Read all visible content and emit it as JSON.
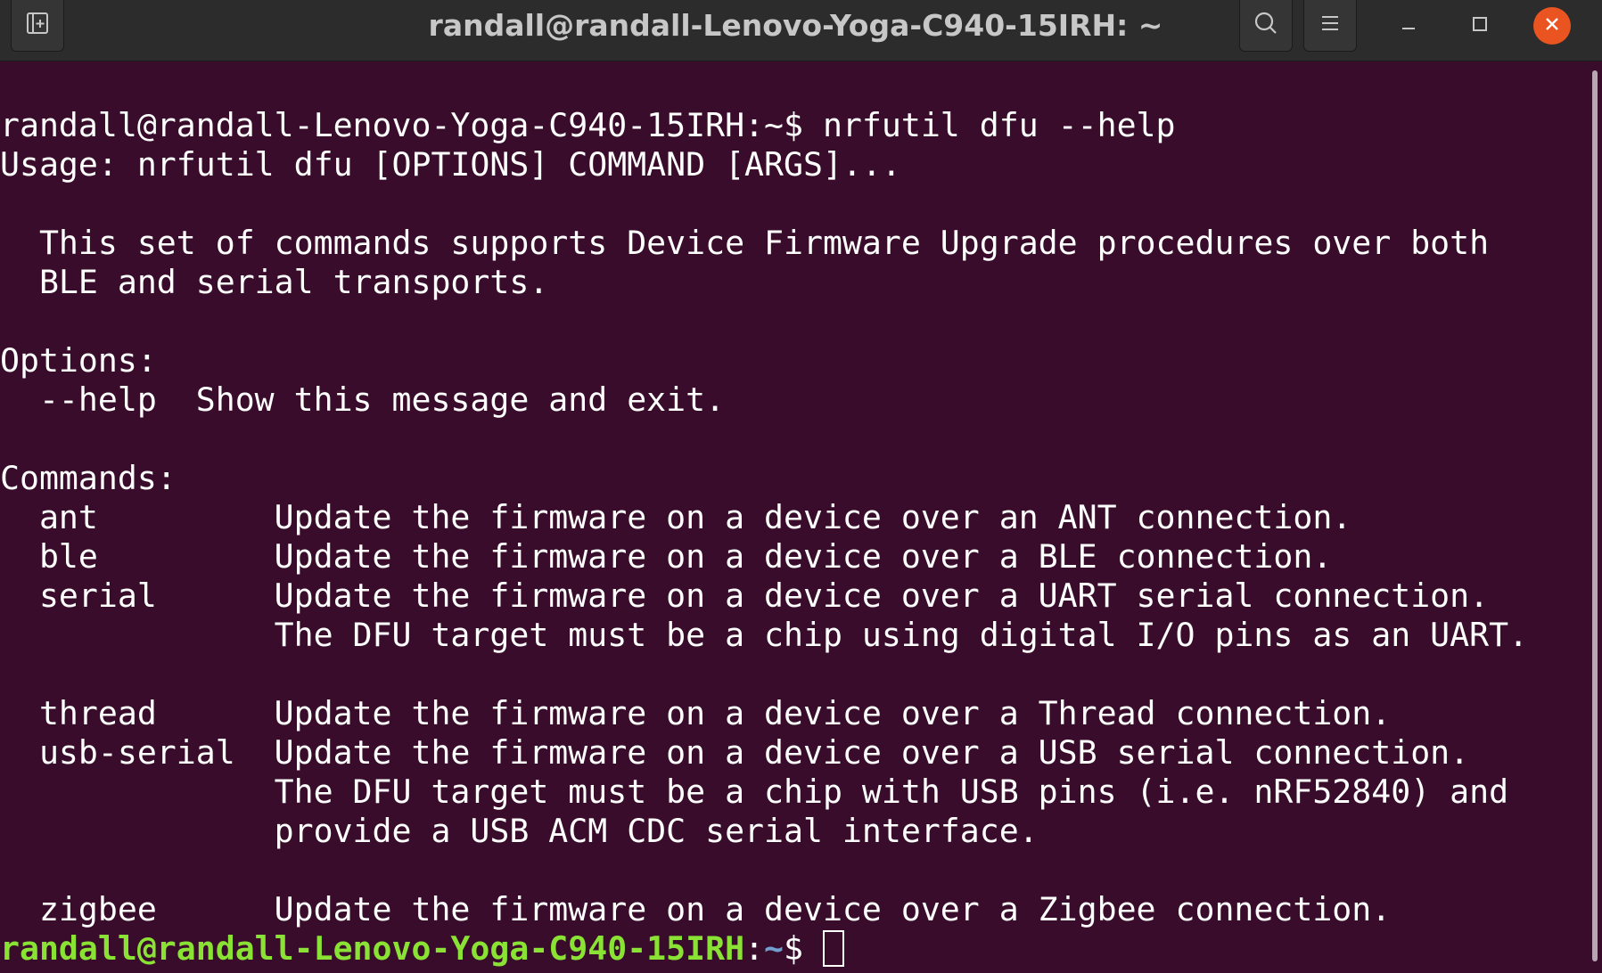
{
  "window": {
    "title": "randall@randall-Lenovo-Yoga-C940-15IRH: ~"
  },
  "icons": {
    "new_tab": "new-tab-icon",
    "search": "search-icon",
    "menu": "hamburger-menu-icon",
    "minimize": "minimize-icon",
    "maximize": "maximize-icon",
    "close": "close-icon"
  },
  "colors": {
    "background": "#380c2a",
    "titlebar": "#2c2c2c",
    "prompt_user": "#8ae234",
    "prompt_path": "#729fcf",
    "close_button": "#e95420"
  },
  "terminal": {
    "lines": [
      "randall@randall-Lenovo-Yoga-C940-15IRH:~$ nrfutil dfu --help",
      "Usage: nrfutil dfu [OPTIONS] COMMAND [ARGS]...",
      "",
      "  This set of commands supports Device Firmware Upgrade procedures over both",
      "  BLE and serial transports.",
      "",
      "Options:",
      "  --help  Show this message and exit.",
      "",
      "Commands:",
      "  ant         Update the firmware on a device over an ANT connection.",
      "  ble         Update the firmware on a device over a BLE connection.",
      "  serial      Update the firmware on a device over a UART serial connection.",
      "              The DFU target must be a chip using digital I/O pins as an UART.",
      "",
      "  thread      Update the firmware on a device over a Thread connection.",
      "  usb-serial  Update the firmware on a device over a USB serial connection.",
      "              The DFU target must be a chip with USB pins (i.e. nRF52840) and",
      "              provide a USB ACM CDC serial interface.",
      "",
      "  zigbee      Update the firmware on a device over a Zigbee connection."
    ],
    "prompt": {
      "user_host": "randall@randall-Lenovo-Yoga-C940-15IRH",
      "colon": ":",
      "path": "~",
      "symbol": "$ "
    }
  }
}
